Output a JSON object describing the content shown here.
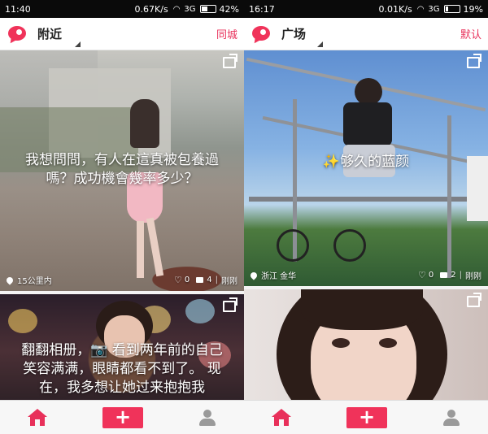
{
  "left_phone": {
    "status": {
      "time": "11:40",
      "speed": "0.67K/s",
      "network": "3G",
      "battery": "42%",
      "battery_level": 0.42
    },
    "appbar": {
      "title": "附近",
      "action": "同城"
    },
    "cards": [
      {
        "caption": "我想問問，有人在這真被包養過嗎？成功機會幾率多少？",
        "location": "15公里内",
        "likes": "0",
        "comments": "4",
        "time": "刚刚"
      },
      {
        "caption": "翻翻相册，📷 看到两年前的自己笑容满满，眼睛都看不到了。 现在，我多想让她过来抱抱我"
      }
    ]
  },
  "right_phone": {
    "status": {
      "time": "16:17",
      "speed": "0.01K/s",
      "network": "3G",
      "battery": "19%",
      "battery_level": 0.19
    },
    "appbar": {
      "title": "广场",
      "action": "默认"
    },
    "cards": [
      {
        "caption": "✨够久的蓝颜",
        "location": "浙江 金华",
        "likes": "0",
        "comments": "2",
        "time": "刚刚"
      },
      {
        "caption": ""
      }
    ]
  },
  "tabbar": {
    "add_label": "+"
  },
  "icons": [
    "logo-icon",
    "share-icon",
    "location-pin-icon",
    "heart-icon",
    "comment-icon",
    "home-icon",
    "add-icon",
    "profile-icon"
  ],
  "colors": {
    "accent": "#f0335a",
    "action_text": "#e8305a"
  }
}
